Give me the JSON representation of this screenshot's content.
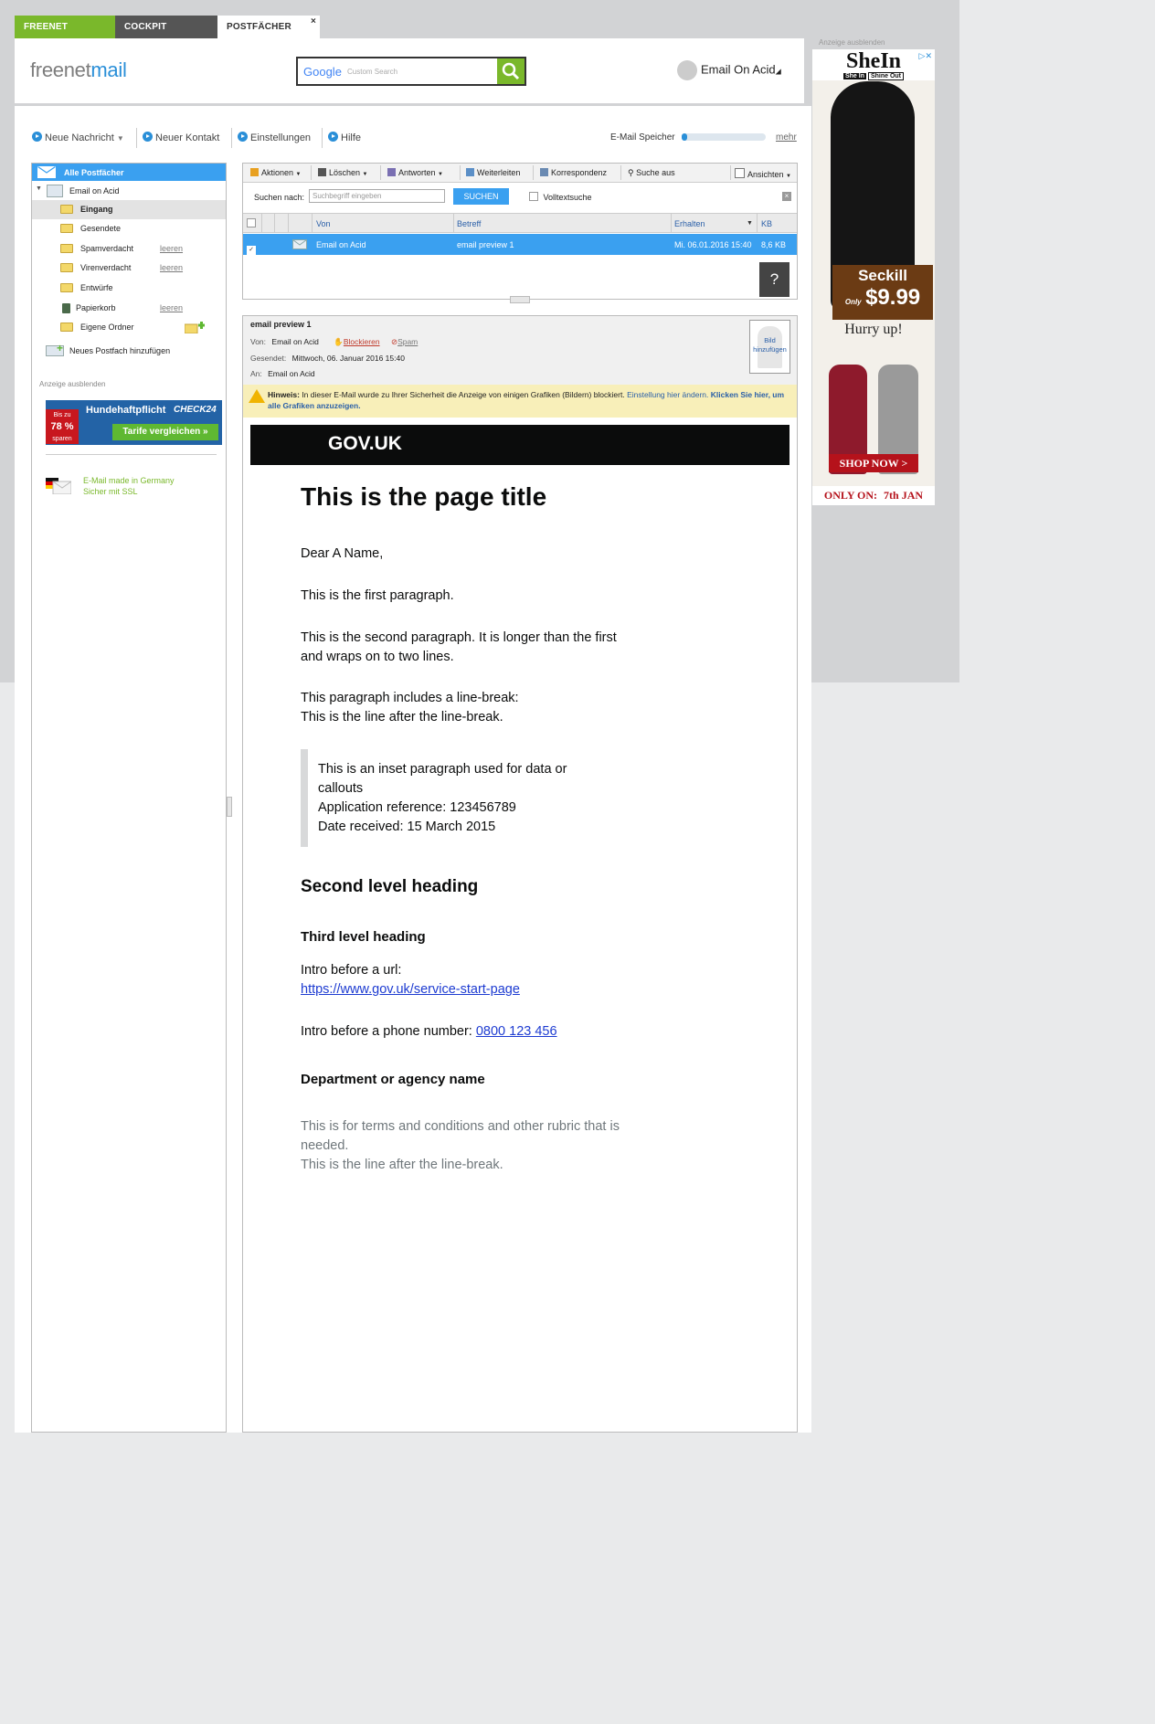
{
  "tabs": [
    {
      "label": "FREENET"
    },
    {
      "label": "COCKPIT"
    },
    {
      "label": "POSTFÄCHER",
      "close": "×"
    }
  ],
  "header": {
    "logo_prefix": "freenet",
    "logo_suffix": "mail",
    "search_brand": "Google",
    "search_placeholder": "Custom Search",
    "user_name": "Email On Acid"
  },
  "toolbar": {
    "new_message": "Neue Nachricht",
    "new_contact": "Neuer Kontakt",
    "settings": "Einstellungen",
    "help": "Hilfe",
    "storage_label": "E-Mail Speicher",
    "storage_fill_fraction": 0.06,
    "more": "mehr"
  },
  "sidebar": {
    "all_mailboxes": "Alle Postfächer",
    "account": "Email on Acid",
    "folders": [
      {
        "label": "Eingang",
        "action": ""
      },
      {
        "label": "Gesendete",
        "action": ""
      },
      {
        "label": "Spamverdacht",
        "action": "leeren"
      },
      {
        "label": "Virenverdacht",
        "action": "leeren"
      },
      {
        "label": "Entwürfe",
        "action": ""
      },
      {
        "label": "Papierkorb",
        "action": "leeren"
      },
      {
        "label": "Eigene Ordner",
        "action": ""
      }
    ],
    "add_mailbox": "Neues Postfach hinzufügen",
    "hide_ad": "Anzeige ausblenden",
    "ad": {
      "title": "Hundehaftpflicht",
      "brand": "CHECK24",
      "button": "Tarife vergleichen »",
      "badge_top": "Bis zu",
      "badge_value": "78 %",
      "badge_bottom": "sparen"
    },
    "made_in_germany": "E-Mail made in Germany",
    "ssl": "Sicher mit SSL"
  },
  "mail_toolbar": {
    "actions": "Aktionen",
    "delete": "Löschen",
    "reply": "Antworten",
    "forward": "Weiterleiten",
    "correspondence": "Korrespondenz",
    "search_off": "Suche aus",
    "views": "Ansichten"
  },
  "search": {
    "label": "Suchen nach:",
    "placeholder": "Suchbegriff eingeben",
    "button": "SUCHEN",
    "fulltext": "Volltextsuche"
  },
  "list": {
    "columns": [
      "Von",
      "Betreff",
      "Erhalten",
      "KB"
    ],
    "rows": [
      {
        "from": "Email on Acid",
        "subject": "email preview 1",
        "received": "Mi. 06.01.2016 15:40",
        "size": "8,6 KB"
      }
    ],
    "help_button": "?"
  },
  "preview": {
    "subject": "email preview 1",
    "from_label": "Von:",
    "from": "Email on Acid",
    "block": "Blockieren",
    "spam": "Spam",
    "sent_label": "Gesendet:",
    "sent": "Mittwoch, 06. Januar 2016 15:40",
    "to_label": "An:",
    "to": "Email on Acid",
    "add_picture": "Bild hinzufügen",
    "notice_bold": "Hinweis:",
    "notice_text": " In dieser E-Mail wurde zu Ihrer Sicherheit die Anzeige von einigen Grafiken (Bildern) blockiert. ",
    "notice_link": "Einstellung hier ändern.",
    "notice_action": " Klicken Sie hier, um alle Grafiken anzuzeigen."
  },
  "email": {
    "brand": "GOV.UK",
    "title": "This is the page title",
    "greeting": "Dear A Name,",
    "p1": "This is the first paragraph.",
    "p2": "This is the second paragraph. It is longer than the first and wraps on to two lines.",
    "p3_line1": "This paragraph includes a line-break:",
    "p3_line2": "This is the line after the line-break.",
    "inset_line1": "This is an inset paragraph used for data or callouts",
    "inset_line2": "Application reference: 123456789",
    "inset_line3": "Date received: 15 March 2015",
    "h2": "Second level heading",
    "h3": "Third level heading",
    "url_intro": "Intro before a url:",
    "url": "https://www.gov.uk/service-start-page",
    "phone_intro": "Intro before a phone number: ",
    "phone": "0800 123 456",
    "dept": "Department or agency name",
    "terms_line1": "This is for terms and conditions and other rubric that is needed.",
    "terms_line2": "This is the line after the line-break."
  },
  "right_ad": {
    "hide": "Anzeige ausblenden",
    "brand": "SheIn",
    "tagline_left": "She In",
    "tagline_right": "Shine Out",
    "seckill": "Seckill",
    "only": "Only",
    "price": "$9.99",
    "hurry": "Hurry up!",
    "shop": "SHOP NOW >",
    "only_on": "ONLY ON:",
    "date": "7th JAN"
  }
}
